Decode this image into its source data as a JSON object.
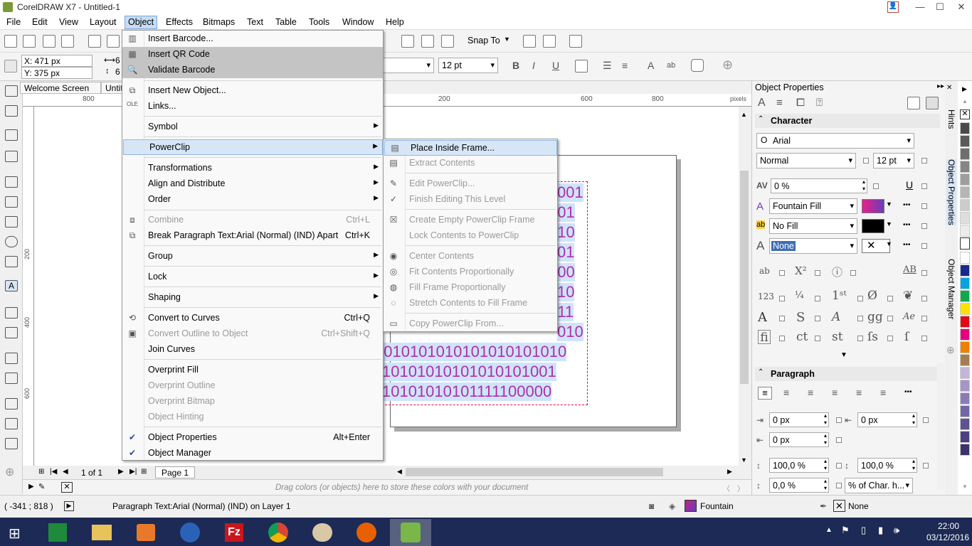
{
  "window": {
    "title": "CorelDRAW X7 - Untitled-1",
    "min": "—",
    "max": "☐",
    "close": "✕"
  },
  "menubar": {
    "items": [
      "File",
      "Edit",
      "View",
      "Layout",
      "Object",
      "Effects",
      "Bitmaps",
      "Text",
      "Table",
      "Tools",
      "Window",
      "Help"
    ]
  },
  "toolbar": {
    "snap_to": "Snap To"
  },
  "propbar": {
    "x": "X: 471 px",
    "y": "Y: 375 px",
    "w_partial": "6",
    "h_partial": "6",
    "font_size": "12 pt"
  },
  "doc_tabs": {
    "welcome": "Welcome Screen",
    "untitled": "Untit"
  },
  "rulers": {
    "units": "pixels",
    "h_ticks": [
      "800",
      "200",
      "400",
      "600",
      "800"
    ],
    "v_ticks": [
      "0",
      "200",
      "400",
      "600"
    ]
  },
  "canvas_text": {
    "lines": [
      "001",
      "001",
      "010",
      "01",
      "000",
      "10",
      "011",
      "010",
      "1010101010101010101010",
      "10101010101010101001",
      "10101010101111100000"
    ]
  },
  "pagebar": {
    "page_count": "1 of 1",
    "page_tab": "Page 1"
  },
  "palette_hint": "Drag colors (or objects) here to store these colors with your document",
  "status": {
    "coords": "( -341 ; 818 )",
    "object": "Paragraph Text:Arial (Normal) (IND) on Layer 1",
    "fill_label": "Fountain",
    "outline_label": "None"
  },
  "taskbar": {
    "time": "22:00",
    "date": "03/12/2016"
  },
  "docker": {
    "title": "Object Properties",
    "character": "Character",
    "font": "Arial",
    "style": "Normal",
    "size": "12 pt",
    "kerning": "0 %",
    "fill_type": "Fountain Fill",
    "bg_fill": "No Fill",
    "outline": "None",
    "paragraph": "Paragraph",
    "indent_left": "0 px",
    "indent_first": "0 px",
    "indent_right": "0 px",
    "line_spacing": "100,0 %",
    "para_spacing": "100,0 %",
    "char_spacing": "0,0 %",
    "spacing_unit": "% of Char. h..."
  },
  "vtabs": {
    "hints": "Hints",
    "object_properties": "Object Properties",
    "object_manager": "Object Manager"
  },
  "object_menu": {
    "items": [
      {
        "label": "Insert Barcode...",
        "state": "normal"
      },
      {
        "label": "Insert QR Code",
        "state": "hl"
      },
      {
        "label": "Validate Barcode",
        "state": "hl"
      },
      {
        "label": "Insert New Object...",
        "state": "normal"
      },
      {
        "label": "Links...",
        "state": "normal"
      },
      {
        "label": "Symbol",
        "state": "normal"
      },
      {
        "label": "PowerClip",
        "state": "hl2"
      },
      {
        "label": "Transformations",
        "state": "normal"
      },
      {
        "label": "Align and Distribute",
        "state": "normal"
      },
      {
        "label": "Order",
        "state": "normal"
      },
      {
        "label": "Combine",
        "state": "dis",
        "shortcut": "Ctrl+L"
      },
      {
        "label": "Break Paragraph Text:Arial (Normal) (IND) Apart",
        "state": "normal",
        "shortcut": "Ctrl+K"
      },
      {
        "label": "Group",
        "state": "normal"
      },
      {
        "label": "Lock",
        "state": "normal"
      },
      {
        "label": "Shaping",
        "state": "normal"
      },
      {
        "label": "Convert to Curves",
        "state": "normal",
        "shortcut": "Ctrl+Q"
      },
      {
        "label": "Convert Outline to Object",
        "state": "dis",
        "shortcut": "Ctrl+Shift+Q"
      },
      {
        "label": "Join Curves",
        "state": "normal"
      },
      {
        "label": "Overprint Fill",
        "state": "normal"
      },
      {
        "label": "Overprint Outline",
        "state": "dis"
      },
      {
        "label": "Overprint Bitmap",
        "state": "dis"
      },
      {
        "label": "Object Hinting",
        "state": "dis"
      },
      {
        "label": "Object Properties",
        "state": "normal",
        "shortcut": "Alt+Enter"
      },
      {
        "label": "Object Manager",
        "state": "normal"
      }
    ]
  },
  "powerclip_menu": {
    "items": [
      {
        "label": "Place Inside Frame...",
        "state": "hl2"
      },
      {
        "label": "Extract Contents",
        "state": "dis"
      },
      {
        "label": "Edit PowerClip...",
        "state": "dis"
      },
      {
        "label": "Finish Editing This Level",
        "state": "dis"
      },
      {
        "label": "Create Empty PowerClip Frame",
        "state": "dis"
      },
      {
        "label": "Lock Contents to PowerClip",
        "state": "dis"
      },
      {
        "label": "Center Contents",
        "state": "dis"
      },
      {
        "label": "Fit Contents Proportionally",
        "state": "dis"
      },
      {
        "label": "Fill Frame Proportionally",
        "state": "dis"
      },
      {
        "label": "Stretch Contents to Fill Frame",
        "state": "dis"
      },
      {
        "label": "Copy PowerClip From...",
        "state": "dis"
      }
    ]
  },
  "colors": {
    "accent": "#3f6db3",
    "menu_hl": "#c4c4c4",
    "fountain_a": "#c0208a",
    "fountain_b": "#6a3eb8",
    "text_pink": "#b030a8",
    "taskbar": "#1d2a55"
  }
}
